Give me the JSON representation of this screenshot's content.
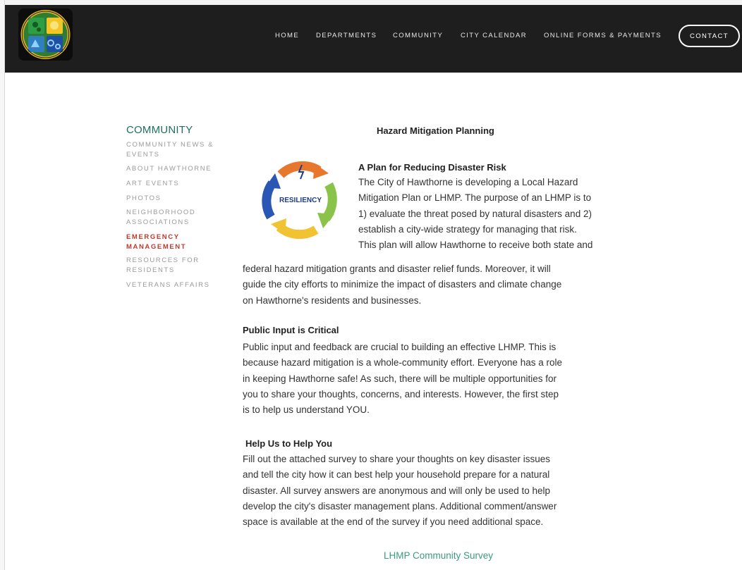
{
  "header": {
    "nav": [
      "HOME",
      "DEPARTMENTS",
      "COMMUNITY",
      "CITY CALENDAR",
      "ONLINE FORMS & PAYMENTS"
    ],
    "contact_label": "CONTACT"
  },
  "sidebar": {
    "title": "COMMUNITY",
    "items": [
      {
        "lines": [
          "COMMUNITY NEWS &",
          "EVENTS"
        ],
        "active": false
      },
      {
        "lines": [
          "ABOUT HAWTHORNE"
        ],
        "active": false
      },
      {
        "lines": [
          "ART EVENTS"
        ],
        "active": false
      },
      {
        "lines": [
          "PHOTOS"
        ],
        "active": false
      },
      {
        "lines": [
          "NEIGHBORHOOD",
          "ASSOCIATIONS"
        ],
        "active": false
      },
      {
        "lines": [
          "EMERGENCY",
          "MANAGEMENT"
        ],
        "active": true
      },
      {
        "lines": [
          "RESOURCES FOR",
          "RESIDENTS"
        ],
        "active": false
      },
      {
        "lines": [
          "VETERANS AFFAIRS"
        ],
        "active": false
      }
    ]
  },
  "main": {
    "page_title": "Hazard Mitigation Planning",
    "image_label": "RESILIENCY",
    "sections": [
      {
        "heading": "A Plan for Reducing Disaster Risk",
        "lines": [
          "The City of Hawthorne is developing a Local Hazard",
          "Mitigation Plan or LHMP. The purpose of an LHMP is to",
          "1) evaluate the threat posed by natural disasters and 2)",
          "establish a city-wide strategy for managing that risk.",
          "This plan will allow Hawthorne to receive both state and",
          "federal hazard mitigation grants and disaster relief funds. Moreover, it will",
          "guide the city efforts to minimize the impact of disasters and climate change",
          "on Hawthorne's residents and businesses."
        ]
      },
      {
        "heading": "Public Input is Critical",
        "lines": [
          "Public input and feedback are crucial to building an effective LHMP. This is",
          "because hazard mitigation is a whole-community effort. Everyone has a role",
          "in keeping Hawthorne safe! As such, there will be multiple opportunities for",
          "you to share your thoughts, concerns, and interests. However, the first step",
          "is to help us understand YOU."
        ]
      },
      {
        "heading": "Help Us to Help You",
        "lines": [
          "Fill out the attached survey to share your thoughts on key disaster issues",
          "and tell the city how it can best help your household prepare for a natural",
          "disaster. All survey answers are anonymous and will only be used to help",
          "develop the city's disaster management plans. Additional comment/answer",
          "space is available at the end of the survey if you need additional space."
        ]
      }
    ],
    "survey_link": "LHMP Community Survey"
  }
}
